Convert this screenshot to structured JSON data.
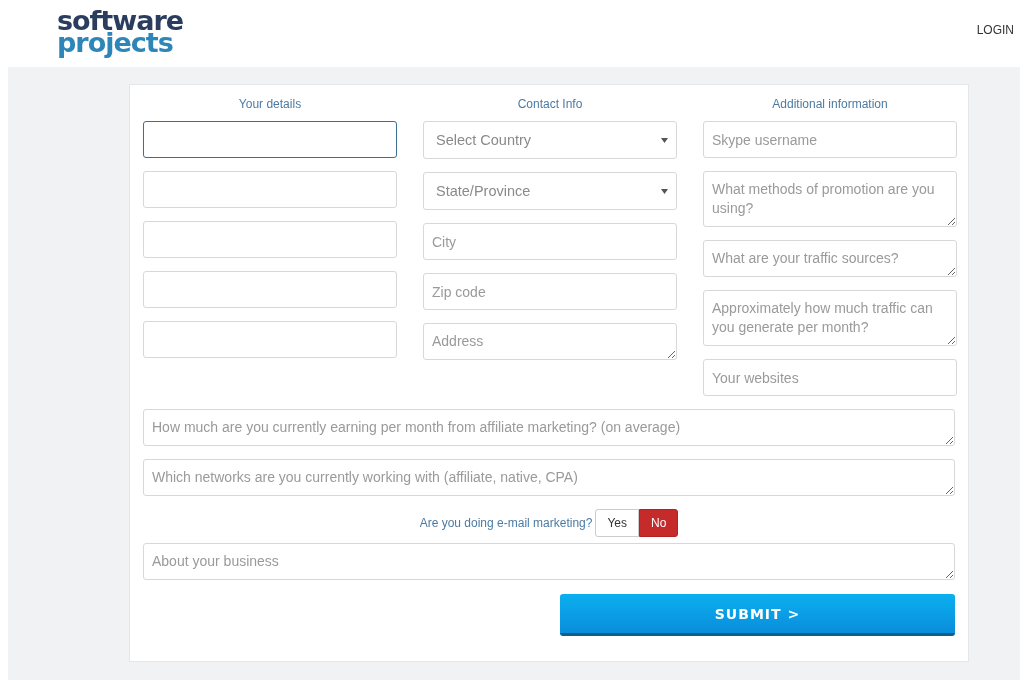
{
  "header": {
    "logo": [
      "software",
      "projects"
    ],
    "login": "LOGIN"
  },
  "columns": [
    {
      "title": "Your details",
      "fields": [
        {
          "kind": "input",
          "focused": true
        },
        {
          "kind": "input",
          "focused": false
        },
        {
          "kind": "input",
          "focused": false
        },
        {
          "kind": "input",
          "focused": false
        },
        {
          "kind": "input",
          "focused": false
        }
      ]
    },
    {
      "title": "Contact Info",
      "fields": [
        {
          "kind": "select",
          "placeholder": "Select Country",
          "focused": false
        },
        {
          "kind": "select",
          "placeholder": "State/Province",
          "focused": false
        },
        {
          "kind": "input",
          "placeholder": "City",
          "focused": false
        },
        {
          "kind": "input",
          "placeholder": "Zip code",
          "focused": false
        },
        {
          "kind": "textarea",
          "placeholder": "Address",
          "focused": false
        }
      ]
    },
    {
      "title": "Additional information",
      "fields": [
        {
          "kind": "input",
          "placeholder": "Skype username",
          "focused": false
        },
        {
          "kind": "textarea",
          "placeholder": "What methods of promotion are you using?",
          "focused": false
        },
        {
          "kind": "textarea",
          "placeholder": "What are your traffic sources?",
          "focused": false
        },
        {
          "kind": "textarea",
          "placeholder": "Approximately how much traffic can you generate per month?",
          "focused": false
        },
        {
          "kind": "input",
          "placeholder": "Your websites",
          "focused": false
        }
      ]
    }
  ],
  "wide_fields": [
    {
      "kind": "textarea",
      "placeholder": "How much are you currently earning per month from affiliate marketing? (on average)",
      "focused": false
    },
    {
      "kind": "textarea",
      "placeholder": "Which networks are you currently working with (affiliate, native, CPA)",
      "focused": false
    }
  ],
  "email_question": {
    "label": "Are you doing e-mail marketing?",
    "options": [
      {
        "label": "Yes",
        "selected": false
      },
      {
        "label": "No",
        "selected": true
      }
    ]
  },
  "about_field": {
    "kind": "textarea",
    "placeholder": "About your business",
    "focused": false
  },
  "submit": "SUBMIT >"
}
